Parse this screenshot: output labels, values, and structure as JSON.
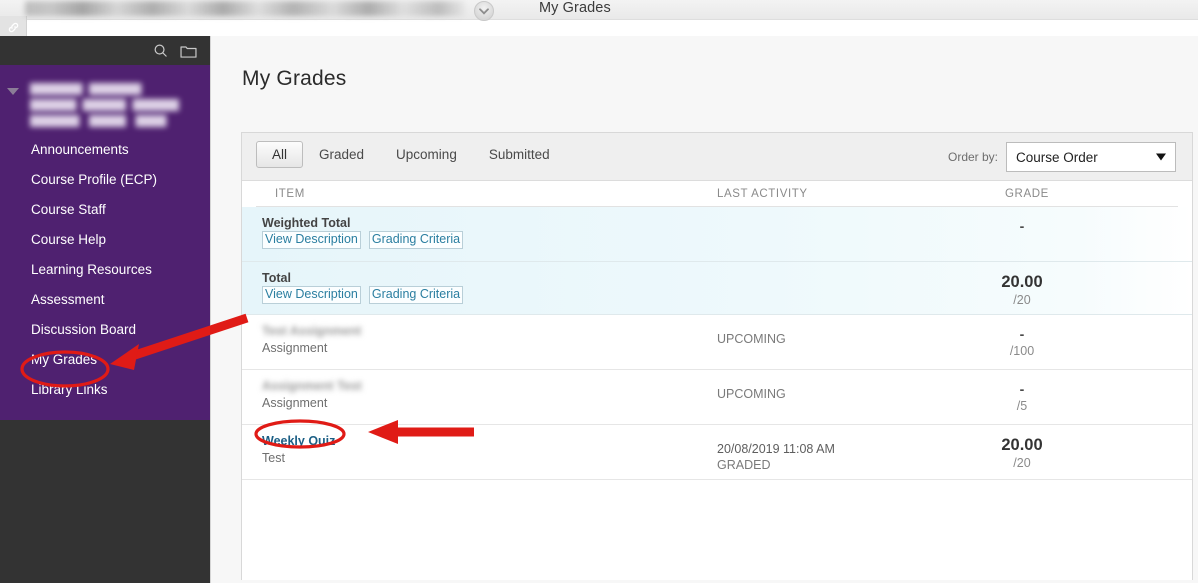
{
  "browser": {
    "link_icon": "chain-link-icon",
    "course_name_blurred": "",
    "course_menu_icon": "chevron-down-circle-icon",
    "breadcrumb": "My Grades"
  },
  "sidebar": {
    "tools": [
      {
        "name": "search-icon",
        "label": "Search"
      },
      {
        "name": "folder-icon",
        "label": "Course Files"
      }
    ],
    "course_title_blurred": "",
    "collapse_icon": "triangle-down-icon",
    "items": [
      {
        "label": "Announcements",
        "name": "sidebar-item-announcements"
      },
      {
        "label": "Course Profile (ECP)",
        "name": "sidebar-item-course-profile"
      },
      {
        "label": "Course Staff",
        "name": "sidebar-item-course-staff"
      },
      {
        "label": "Course Help",
        "name": "sidebar-item-course-help"
      },
      {
        "label": "Learning Resources",
        "name": "sidebar-item-learning-resources"
      },
      {
        "label": "Assessment",
        "name": "sidebar-item-assessment"
      },
      {
        "label": "Discussion Board",
        "name": "sidebar-item-discussion-board"
      },
      {
        "label": "My Grades",
        "name": "sidebar-item-my-grades"
      },
      {
        "label": "Library Links",
        "name": "sidebar-item-library-links"
      }
    ]
  },
  "main": {
    "page_title": "My Grades",
    "tabs": [
      {
        "label": "All",
        "active": true
      },
      {
        "label": "Graded",
        "active": false
      },
      {
        "label": "Upcoming",
        "active": false
      },
      {
        "label": "Submitted",
        "active": false
      }
    ],
    "order_by": {
      "label": "Order by:",
      "value": "Course Order"
    },
    "columns": {
      "item": "ITEM",
      "last_activity": "LAST ACTIVITY",
      "grade": "GRADE"
    },
    "rows": [
      {
        "title": "Weighted Total",
        "type": "total",
        "links": [
          "View Description",
          "Grading Criteria"
        ],
        "activity": "",
        "status": "",
        "score": "-",
        "points": ""
      },
      {
        "title": "Total",
        "type": "total",
        "links": [
          "View Description",
          "Grading Criteria"
        ],
        "activity": "",
        "status": "",
        "score": "20.00",
        "points": "/20"
      },
      {
        "title": "Test Assignment",
        "title_blurred": true,
        "subtitle": "Assignment",
        "activity": "",
        "status": "UPCOMING",
        "score": "-",
        "points": "/100"
      },
      {
        "title": "Assignment Test",
        "title_blurred": true,
        "subtitle": "Assignment",
        "activity": "",
        "status": "UPCOMING",
        "score": "-",
        "points": "/5"
      },
      {
        "title": "Weekly Quiz",
        "title_blurred": false,
        "is_link": true,
        "subtitle": "Test",
        "activity": "20/08/2019 11:08 AM",
        "status": "GRADED",
        "score": "20.00",
        "points": "/20"
      }
    ]
  },
  "annotations": {
    "color": "#e01b16",
    "shapes": [
      {
        "name": "ellipse-my-grades",
        "type": "ellipse"
      },
      {
        "name": "arrow-to-my-grades",
        "type": "arrow"
      },
      {
        "name": "ellipse-weekly-quiz",
        "type": "ellipse"
      },
      {
        "name": "arrow-to-weekly-quiz",
        "type": "arrow"
      }
    ]
  }
}
